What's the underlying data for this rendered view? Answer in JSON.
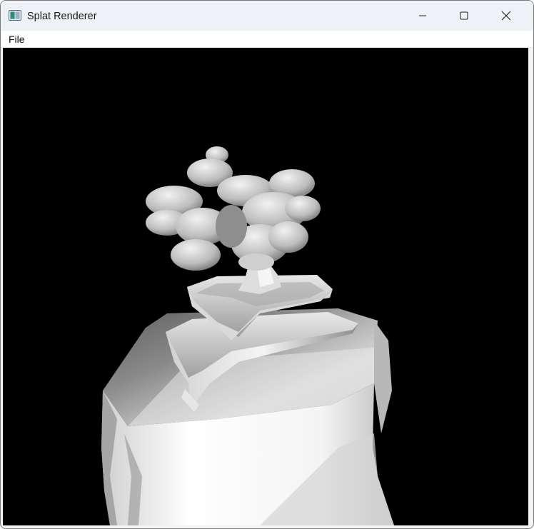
{
  "window": {
    "title": "Splat Renderer",
    "app_icon": "window-app-icon",
    "controls": {
      "minimize_icon": "minimize-icon",
      "maximize_icon": "maximize-icon",
      "close_icon": "close-icon"
    }
  },
  "menubar": {
    "items": [
      {
        "label": "File"
      }
    ]
  },
  "viewport": {
    "background": "#000000",
    "content": "rendered-bonsai-scene"
  }
}
